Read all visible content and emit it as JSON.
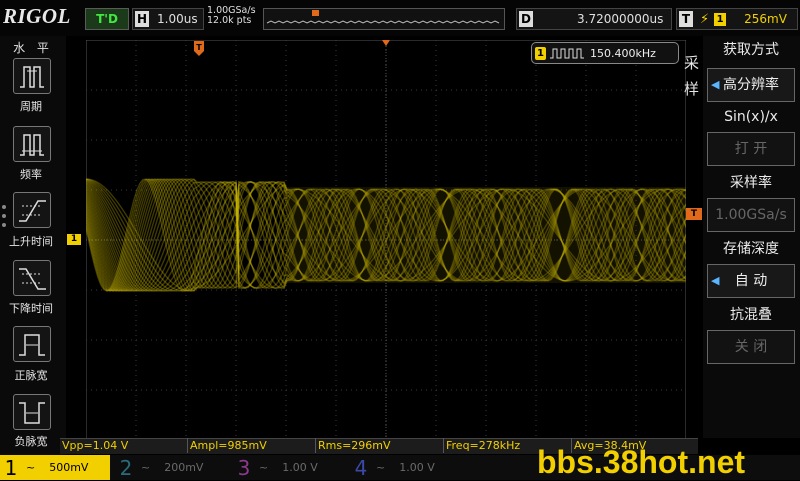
{
  "brand": "RIGOL",
  "top": {
    "run_status": "T'D",
    "horizontal_label": "H",
    "timebase": "1.00us",
    "sample_rate": "1.00GSa/s",
    "memory_points": "12.0k pts",
    "delay_label": "D",
    "delay": "3.72000000us",
    "trigger_label": "T",
    "trigger_edge_icon": "rising-edge-icon",
    "trigger_channel": "1",
    "trigger_level": "256mV"
  },
  "left_menu": {
    "title": "水 平",
    "items": [
      {
        "label": "周期",
        "icon": "period-icon"
      },
      {
        "label": "频率",
        "icon": "frequency-icon"
      },
      {
        "label": "上升时间",
        "icon": "rise-time-icon"
      },
      {
        "label": "下降时间",
        "icon": "fall-time-icon"
      },
      {
        "label": "正脉宽",
        "icon": "positive-width-icon"
      },
      {
        "label": "负脉宽",
        "icon": "negative-width-icon"
      }
    ]
  },
  "freq_counter": {
    "channel": "1",
    "value": "150.400kHz"
  },
  "side_title": "采样",
  "right_menu": {
    "items": [
      {
        "header": "获取方式",
        "value": "高分辨率",
        "enabled": true
      },
      {
        "header": "Sin(x)/x",
        "value": "打 开",
        "enabled": false
      },
      {
        "header": "采样率",
        "value": "1.00GSa/s",
        "enabled": false
      },
      {
        "header": "存储深度",
        "value": "自 动",
        "enabled": true
      },
      {
        "header": "抗混叠",
        "value": "关 闭",
        "enabled": false
      }
    ]
  },
  "measurements": [
    {
      "label": "Vpp=1.04 V"
    },
    {
      "label": "Ampl=985mV"
    },
    {
      "label": "Rms=296mV"
    },
    {
      "label": "Freq=278kHz"
    },
    {
      "label": "Avg=38.4mV"
    }
  ],
  "channels": [
    {
      "num": "1",
      "coupling": "~",
      "scale": "500mV",
      "color": "#f2d000"
    },
    {
      "num": "2",
      "coupling": "~",
      "scale": "200mV",
      "color": "#2a6a7a"
    },
    {
      "num": "3",
      "coupling": "~",
      "scale": "1.00 V",
      "color": "#8a3a8a"
    },
    {
      "num": "4",
      "coupling": "~",
      "scale": "1.00 V",
      "color": "#3a4aa8"
    }
  ],
  "markers": {
    "ch1": "1",
    "trigger_level": "T",
    "trigger_position": "T"
  },
  "watermark": "bbs.38hot.net",
  "colors": {
    "ch1": "#f2d000",
    "trigger": "#e06a1a",
    "grid": "#3a3a3a"
  }
}
